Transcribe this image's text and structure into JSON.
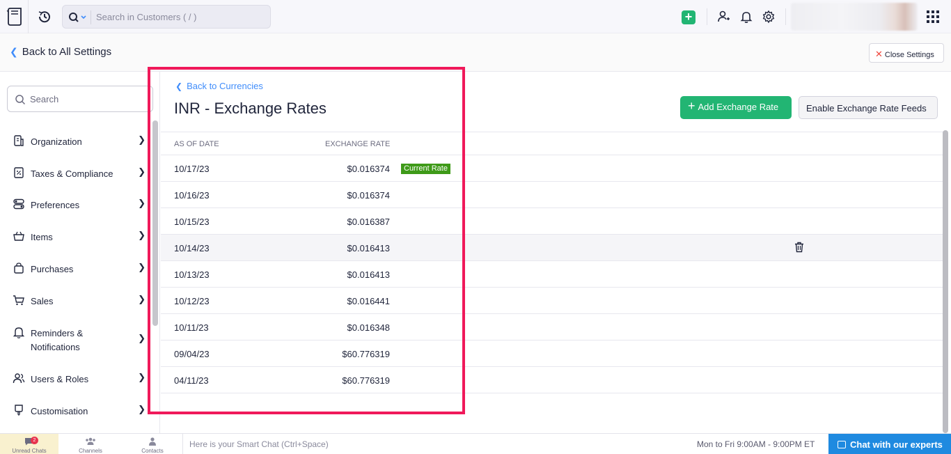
{
  "topbar": {
    "search_placeholder": "Search in Customers ( / )"
  },
  "settings_header": {
    "back_label": "Back to All Settings",
    "close_label": "Close Settings"
  },
  "sidebar": {
    "search_placeholder": "Search",
    "items": [
      {
        "label": "Organization",
        "icon": "building-icon"
      },
      {
        "label": "Taxes & Compliance",
        "icon": "tax-document-icon"
      },
      {
        "label": "Preferences",
        "icon": "toggles-icon"
      },
      {
        "label": "Items",
        "icon": "basket-icon"
      },
      {
        "label": "Purchases",
        "icon": "shopping-bag-icon"
      },
      {
        "label": "Sales",
        "icon": "cart-icon"
      },
      {
        "label": "Reminders &",
        "label2": "Notifications",
        "icon": "bell-icon"
      },
      {
        "label": "Users & Roles",
        "icon": "users-icon"
      },
      {
        "label": "Customisation",
        "icon": "brush-icon"
      }
    ]
  },
  "main": {
    "back_label": "Back to Currencies",
    "title": "INR - Exchange Rates",
    "add_button": "Add Exchange Rate",
    "feeds_button": "Enable Exchange Rate Feeds",
    "columns": [
      "AS OF DATE",
      "EXCHANGE RATE"
    ],
    "current_badge": "Current Rate",
    "rows": [
      {
        "date": "10/17/23",
        "rate": "$0.016374"
      },
      {
        "date": "10/16/23",
        "rate": "$0.016374"
      },
      {
        "date": "10/15/23",
        "rate": "$0.016387"
      },
      {
        "date": "10/14/23",
        "rate": "$0.016413"
      },
      {
        "date": "10/13/23",
        "rate": "$0.016413"
      },
      {
        "date": "10/12/23",
        "rate": "$0.016441"
      },
      {
        "date": "10/11/23",
        "rate": "$0.016348"
      },
      {
        "date": "09/04/23",
        "rate": "$60.776319"
      },
      {
        "date": "04/11/23",
        "rate": "$60.776319"
      }
    ]
  },
  "bottombar": {
    "tabs": [
      "Unread Chats",
      "Channels",
      "Contacts"
    ],
    "unread_count": "2",
    "chat_placeholder": "Here is your Smart Chat (Ctrl+Space)",
    "hours": "Mon to Fri 9:00AM - 9:00PM ET",
    "experts_label": "Chat with our experts"
  },
  "colors": {
    "accent_green": "#22b573",
    "link_blue": "#408dfb",
    "badge_green": "#3e9a18",
    "highlight": "#f0195a",
    "chat_blue": "#1f8ae0"
  }
}
